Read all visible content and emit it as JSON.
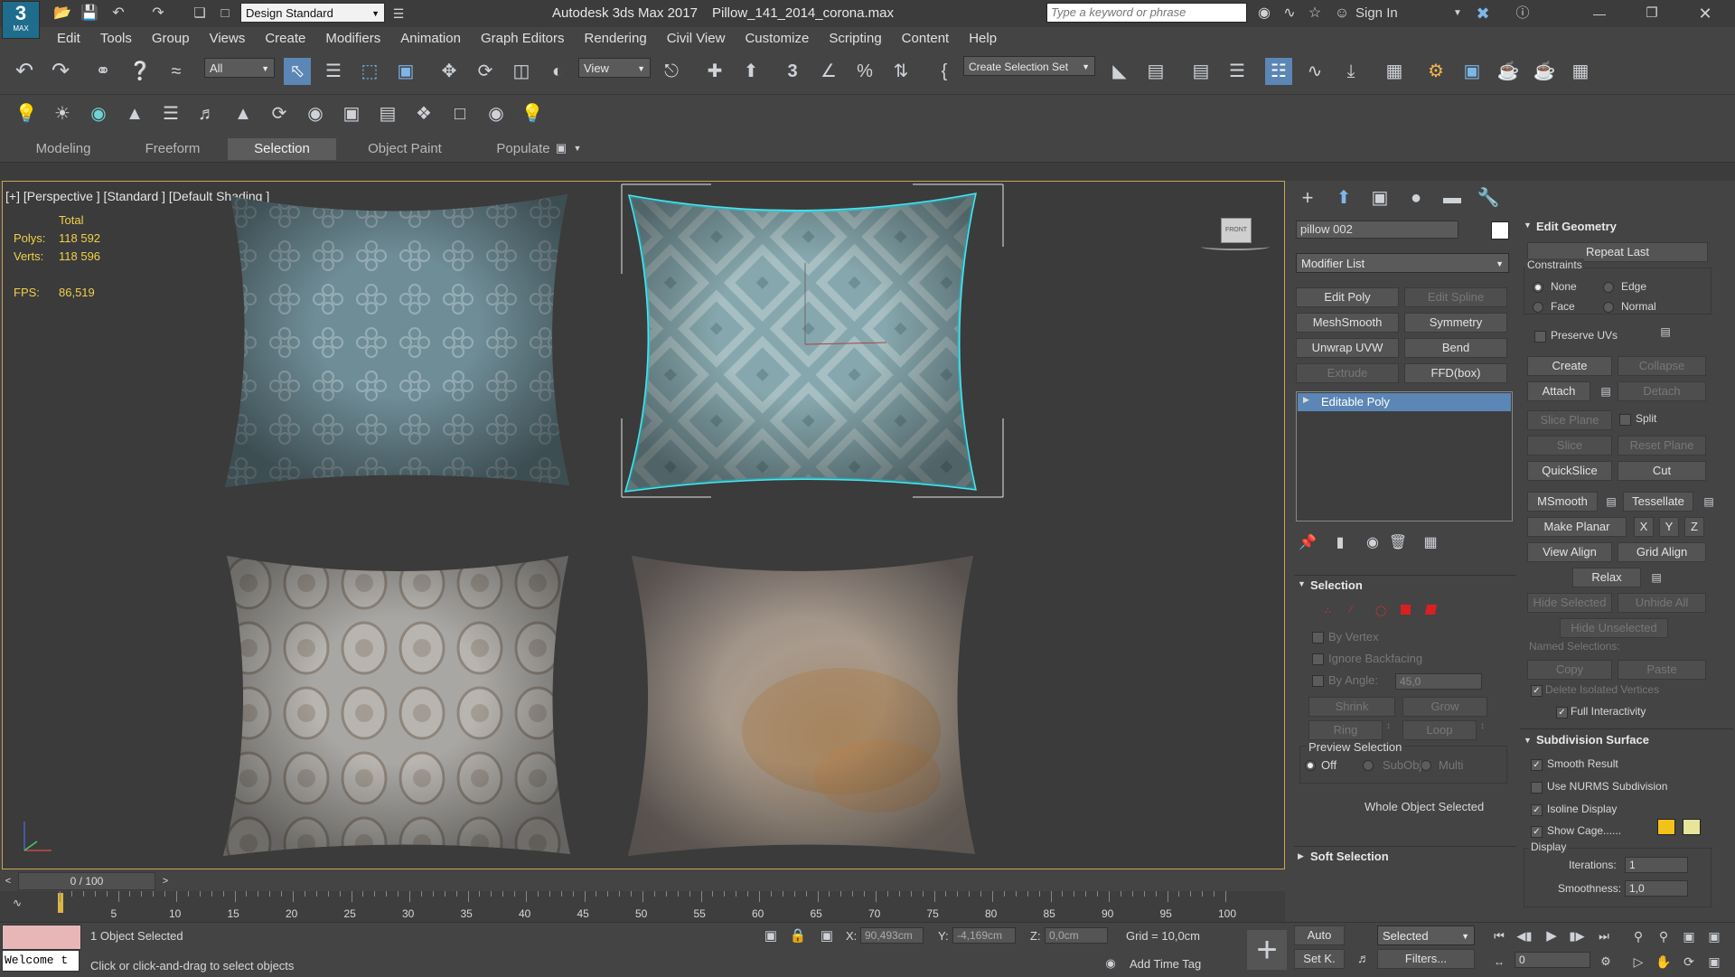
{
  "title_bar": {
    "app_logo": "3",
    "app_logo_sub": "MAX",
    "workspace": "Design Standard",
    "window_title": "Autodesk 3ds Max 2017",
    "file_name": "Pillow_141_2014_corona.max",
    "search_placeholder": "Type a keyword or phrase",
    "sign_in": "Sign In"
  },
  "menu": [
    "Edit",
    "Tools",
    "Group",
    "Views",
    "Create",
    "Modifiers",
    "Animation",
    "Graph Editors",
    "Rendering",
    "Civil View",
    "Customize",
    "Scripting",
    "Content",
    "Help"
  ],
  "toolbar": {
    "filter_value": "All",
    "ref_coord": "View",
    "selection_set": "Create Selection Set"
  },
  "ribbon_tabs": [
    "Modeling",
    "Freeform",
    "Selection",
    "Object Paint",
    "Populate"
  ],
  "ribbon_active": "Selection",
  "viewport": {
    "label": "[+] [Perspective ] [Standard ] [Default Shading ]",
    "stats_total": "Total",
    "polys_label": "Polys:",
    "polys_value": "118 592",
    "verts_label": "Verts:",
    "verts_value": "118 596",
    "fps_label": "FPS:",
    "fps_value": "86,519",
    "viewcube_label": "FRONT"
  },
  "command_panel": {
    "object_name": "pillow 002",
    "modifier_list": "Modifier List",
    "modifier_buttons": [
      "Edit Poly",
      "Edit Spline",
      "MeshSmooth",
      "Symmetry",
      "Unwrap UVW",
      "Bend",
      "Extrude",
      "FFD(box)"
    ],
    "stack_item": "Editable Poly",
    "selection": {
      "header": "Selection",
      "by_vertex": "By Vertex",
      "ignore_backfacing": "Ignore Backfacing",
      "by_angle": "By Angle:",
      "by_angle_value": "45,0",
      "shrink": "Shrink",
      "grow": "Grow",
      "ring": "Ring",
      "loop": "Loop",
      "preview_selection": "Preview Selection",
      "off": "Off",
      "subobj": "SubObj",
      "multi": "Multi",
      "status": "Whole Object Selected"
    },
    "soft_selection": "Soft Selection",
    "edit_geometry": {
      "header": "Edit Geometry",
      "repeat_last": "Repeat Last",
      "constraints": "Constraints",
      "none": "None",
      "edge": "Edge",
      "face": "Face",
      "normal": "Normal",
      "preserve_uvs": "Preserve UVs",
      "create": "Create",
      "collapse": "Collapse",
      "attach": "Attach",
      "detach": "Detach",
      "slice_plane": "Slice Plane",
      "split": "Split",
      "slice": "Slice",
      "reset_plane": "Reset Plane",
      "quickslice": "QuickSlice",
      "cut": "Cut",
      "msmooth": "MSmooth",
      "tessellate": "Tessellate",
      "make_planar": "Make Planar",
      "x": "X",
      "y": "Y",
      "z": "Z",
      "view_align": "View Align",
      "grid_align": "Grid Align",
      "relax": "Relax",
      "hide_selected": "Hide Selected",
      "unhide_all": "Unhide All",
      "hide_unselected": "Hide Unselected",
      "named_selections": "Named Selections:",
      "copy": "Copy",
      "paste": "Paste",
      "delete_isolated": "Delete Isolated Vertices",
      "full_interactivity": "Full Interactivity"
    },
    "subdivision": {
      "header": "Subdivision Surface",
      "smooth_result": "Smooth Result",
      "use_nurms": "Use NURMS Subdivision",
      "isoline": "Isoline Display",
      "show_cage": "Show Cage......",
      "display": "Display",
      "iterations": "Iterations:",
      "iterations_value": "1",
      "smoothness": "Smoothness:",
      "smoothness_value": "1,0"
    },
    "cage_color_1": "#f2c21a",
    "cage_color_2": "#e8e49a"
  },
  "timeline": {
    "counter": "0 / 100",
    "ticks": [
      "5",
      "10",
      "15",
      "20",
      "25",
      "30",
      "35",
      "40",
      "45",
      "50",
      "55",
      "60",
      "65",
      "70",
      "75",
      "80",
      "85",
      "90",
      "95",
      "100"
    ]
  },
  "status": {
    "maxscript": "Welcome t",
    "selected": "1 Object Selected",
    "prompt": "Click or click-and-drag to select objects",
    "x_label": "X:",
    "x_value": "90,493cm",
    "y_label": "Y:",
    "y_value": "-4,169cm",
    "z_label": "Z:",
    "z_value": "0,0cm",
    "grid": "Grid = 10,0cm",
    "add_time_tag": "Add Time Tag",
    "auto": "Auto",
    "set_k": "Set K.",
    "selected_dd": "Selected",
    "filters": "Filters...",
    "frame": "0"
  }
}
